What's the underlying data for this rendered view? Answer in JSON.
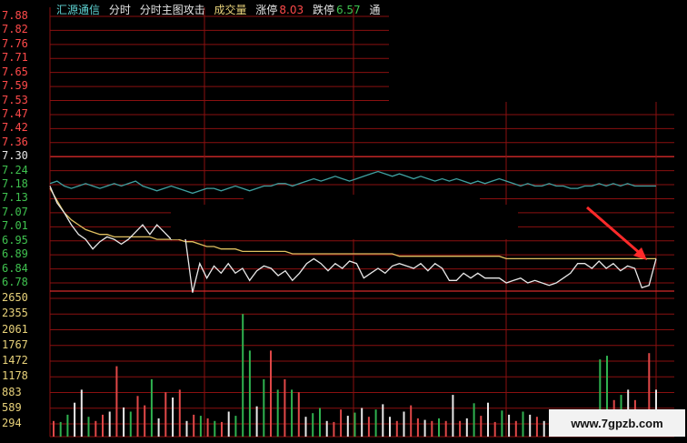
{
  "header": {
    "stock_name": "汇源通信",
    "mode_label": "分时",
    "view_label": "分时主图攻击",
    "volume_label": "成交量",
    "limit_up_label": "涨停",
    "limit_up_value": "8.03",
    "limit_down_label": "跌停",
    "limit_down_value": "6.57",
    "extra_label": "通"
  },
  "price_axis": [
    "7.88",
    "7.82",
    "7.76",
    "7.71",
    "7.65",
    "7.59",
    "7.53",
    "7.47",
    "7.42",
    "7.36",
    "7.30",
    "7.24",
    "7.18",
    "7.13",
    "7.07",
    "7.01",
    "6.95",
    "6.89",
    "6.84",
    "6.78"
  ],
  "volume_axis": [
    "2650",
    "2355",
    "2061",
    "1767",
    "1472",
    "1178",
    "883",
    "589",
    "294"
  ],
  "watermark": "www.7gpzb.com",
  "colors": {
    "grid_red": "#8a1010",
    "mid_line": "#d42a2a",
    "price_line": "#e8e8e8",
    "avg_line": "#e0c060",
    "index_line": "#3fa0a0",
    "arrow": "#ff2a2a",
    "vol_red": "#e04848",
    "vol_green": "#2fb24f",
    "vol_white": "#e8e8e8"
  },
  "chart_data": {
    "type": "line",
    "title": "",
    "ylim": [
      6.78,
      7.88
    ],
    "series": [
      {
        "name": "",
        "values": [
          7.18,
          7.11,
          7.07,
          7.02,
          6.98,
          6.96,
          6.92,
          6.95,
          6.97,
          6.96,
          6.94,
          6.96,
          6.99,
          7.02,
          6.98,
          7.02,
          6.99,
          6.96,
          6.98,
          6.96,
          6.74,
          6.86,
          6.8,
          6.85,
          6.82,
          6.86,
          6.82,
          6.84,
          6.79,
          6.83,
          6.85,
          6.84,
          6.81,
          6.83,
          6.79,
          6.82,
          6.86,
          6.88,
          6.86,
          6.83,
          6.86,
          6.84,
          6.87,
          6.86,
          6.8,
          6.82,
          6.84,
          6.82,
          6.85,
          6.86,
          6.85,
          6.84,
          6.86,
          6.83,
          6.86,
          6.84,
          6.79,
          6.79,
          6.82,
          6.8,
          6.82,
          6.8,
          6.8,
          6.8,
          6.78,
          6.79,
          6.8,
          6.78,
          6.79,
          6.78,
          6.77,
          6.78,
          6.8,
          6.82,
          6.86,
          6.86,
          6.84,
          6.87,
          6.84,
          6.86,
          6.83,
          6.85,
          6.84,
          6.76,
          6.77,
          6.88
        ]
      },
      {
        "name": "",
        "values": [
          7.17,
          7.12,
          7.07,
          7.04,
          7.02,
          7.0,
          6.99,
          6.98,
          6.98,
          6.97,
          6.97,
          6.97,
          6.97,
          6.97,
          6.97,
          6.96,
          6.96,
          6.96,
          6.96,
          6.95,
          6.95,
          6.94,
          6.93,
          6.93,
          6.92,
          6.92,
          6.92,
          6.91,
          6.91,
          6.91,
          6.91,
          6.91,
          6.91,
          6.91,
          6.9,
          6.9,
          6.9,
          6.9,
          6.9,
          6.9,
          6.9,
          6.9,
          6.9,
          6.9,
          6.9,
          6.9,
          6.9,
          6.9,
          6.9,
          6.89,
          6.89,
          6.89,
          6.89,
          6.89,
          6.89,
          6.89,
          6.89,
          6.89,
          6.89,
          6.89,
          6.89,
          6.89,
          6.89,
          6.89,
          6.88,
          6.88,
          6.88,
          6.88,
          6.88,
          6.88,
          6.88,
          6.88,
          6.88,
          6.88,
          6.88,
          6.88,
          6.88,
          6.88,
          6.88,
          6.88,
          6.88,
          6.88,
          6.88,
          6.88,
          6.88,
          6.88
        ]
      },
      {
        "name": "",
        "values": [
          7.19,
          7.2,
          7.18,
          7.17,
          7.18,
          7.19,
          7.18,
          7.17,
          7.18,
          7.19,
          7.18,
          7.19,
          7.2,
          7.18,
          7.17,
          7.16,
          7.17,
          7.18,
          7.17,
          7.16,
          7.15,
          7.16,
          7.17,
          7.17,
          7.16,
          7.17,
          7.18,
          7.17,
          7.16,
          7.17,
          7.18,
          7.18,
          7.19,
          7.19,
          7.18,
          7.19,
          7.2,
          7.21,
          7.2,
          7.21,
          7.22,
          7.21,
          7.2,
          7.21,
          7.22,
          7.23,
          7.24,
          7.23,
          7.22,
          7.23,
          7.22,
          7.21,
          7.22,
          7.21,
          7.2,
          7.21,
          7.2,
          7.21,
          7.2,
          7.19,
          7.2,
          7.19,
          7.2,
          7.21,
          7.2,
          7.19,
          7.18,
          7.19,
          7.18,
          7.18,
          7.19,
          7.18,
          7.18,
          7.17,
          7.17,
          7.18,
          7.18,
          7.19,
          7.18,
          7.19,
          7.18,
          7.19,
          7.18,
          7.18,
          7.18,
          7.18
        ]
      }
    ],
    "volume": {
      "ylim": [
        0,
        2650
      ],
      "bars": [
        {
          "v": 300,
          "c": "r"
        },
        {
          "v": 280,
          "c": "g"
        },
        {
          "v": 420,
          "c": "g"
        },
        {
          "v": 650,
          "c": "w"
        },
        {
          "v": 900,
          "c": "w"
        },
        {
          "v": 380,
          "c": "g"
        },
        {
          "v": 300,
          "c": "r"
        },
        {
          "v": 420,
          "c": "r"
        },
        {
          "v": 480,
          "c": "w"
        },
        {
          "v": 1350,
          "c": "r"
        },
        {
          "v": 560,
          "c": "w"
        },
        {
          "v": 480,
          "c": "g"
        },
        {
          "v": 780,
          "c": "r"
        },
        {
          "v": 600,
          "c": "r"
        },
        {
          "v": 1100,
          "c": "g"
        },
        {
          "v": 350,
          "c": "w"
        },
        {
          "v": 850,
          "c": "r"
        },
        {
          "v": 750,
          "c": "w"
        },
        {
          "v": 900,
          "c": "r"
        },
        {
          "v": 300,
          "c": "w"
        },
        {
          "v": 420,
          "c": "r"
        },
        {
          "v": 400,
          "c": "g"
        },
        {
          "v": 350,
          "c": "r"
        },
        {
          "v": 300,
          "c": "g"
        },
        {
          "v": 280,
          "c": "r"
        },
        {
          "v": 480,
          "c": "w"
        },
        {
          "v": 400,
          "c": "g"
        },
        {
          "v": 2350,
          "c": "g"
        },
        {
          "v": 1650,
          "c": "g"
        },
        {
          "v": 580,
          "c": "w"
        },
        {
          "v": 1100,
          "c": "g"
        },
        {
          "v": 1650,
          "c": "r"
        },
        {
          "v": 900,
          "c": "g"
        },
        {
          "v": 1100,
          "c": "r"
        },
        {
          "v": 900,
          "c": "g"
        },
        {
          "v": 850,
          "c": "r"
        },
        {
          "v": 380,
          "c": "w"
        },
        {
          "v": 450,
          "c": "g"
        },
        {
          "v": 550,
          "c": "g"
        },
        {
          "v": 300,
          "c": "w"
        },
        {
          "v": 280,
          "c": "r"
        },
        {
          "v": 520,
          "c": "r"
        },
        {
          "v": 400,
          "c": "w"
        },
        {
          "v": 460,
          "c": "g"
        },
        {
          "v": 550,
          "c": "w"
        },
        {
          "v": 380,
          "c": "r"
        },
        {
          "v": 520,
          "c": "g"
        },
        {
          "v": 620,
          "c": "w"
        },
        {
          "v": 380,
          "c": "w"
        },
        {
          "v": 300,
          "c": "r"
        },
        {
          "v": 480,
          "c": "w"
        },
        {
          "v": 600,
          "c": "r"
        },
        {
          "v": 350,
          "c": "r"
        },
        {
          "v": 320,
          "c": "w"
        },
        {
          "v": 300,
          "c": "r"
        },
        {
          "v": 350,
          "c": "g"
        },
        {
          "v": 300,
          "c": "r"
        },
        {
          "v": 800,
          "c": "w"
        },
        {
          "v": 300,
          "c": "r"
        },
        {
          "v": 350,
          "c": "w"
        },
        {
          "v": 640,
          "c": "g"
        },
        {
          "v": 400,
          "c": "r"
        },
        {
          "v": 650,
          "c": "w"
        },
        {
          "v": 280,
          "c": "r"
        },
        {
          "v": 500,
          "c": "g"
        },
        {
          "v": 420,
          "c": "w"
        },
        {
          "v": 300,
          "c": "r"
        },
        {
          "v": 480,
          "c": "g"
        },
        {
          "v": 420,
          "c": "w"
        },
        {
          "v": 380,
          "c": "r"
        },
        {
          "v": 300,
          "c": "w"
        },
        {
          "v": 350,
          "c": "g"
        },
        {
          "v": 300,
          "c": "w"
        },
        {
          "v": 420,
          "c": "g"
        },
        {
          "v": 450,
          "c": "g"
        },
        {
          "v": 280,
          "c": "w"
        },
        {
          "v": 300,
          "c": "g"
        },
        {
          "v": 280,
          "c": "w"
        },
        {
          "v": 1480,
          "c": "g"
        },
        {
          "v": 1550,
          "c": "g"
        },
        {
          "v": 700,
          "c": "r"
        },
        {
          "v": 800,
          "c": "g"
        },
        {
          "v": 900,
          "c": "w"
        },
        {
          "v": 700,
          "c": "r"
        },
        {
          "v": 500,
          "c": "g"
        },
        {
          "v": 1600,
          "c": "r"
        },
        {
          "v": 900,
          "c": "w"
        }
      ]
    }
  }
}
